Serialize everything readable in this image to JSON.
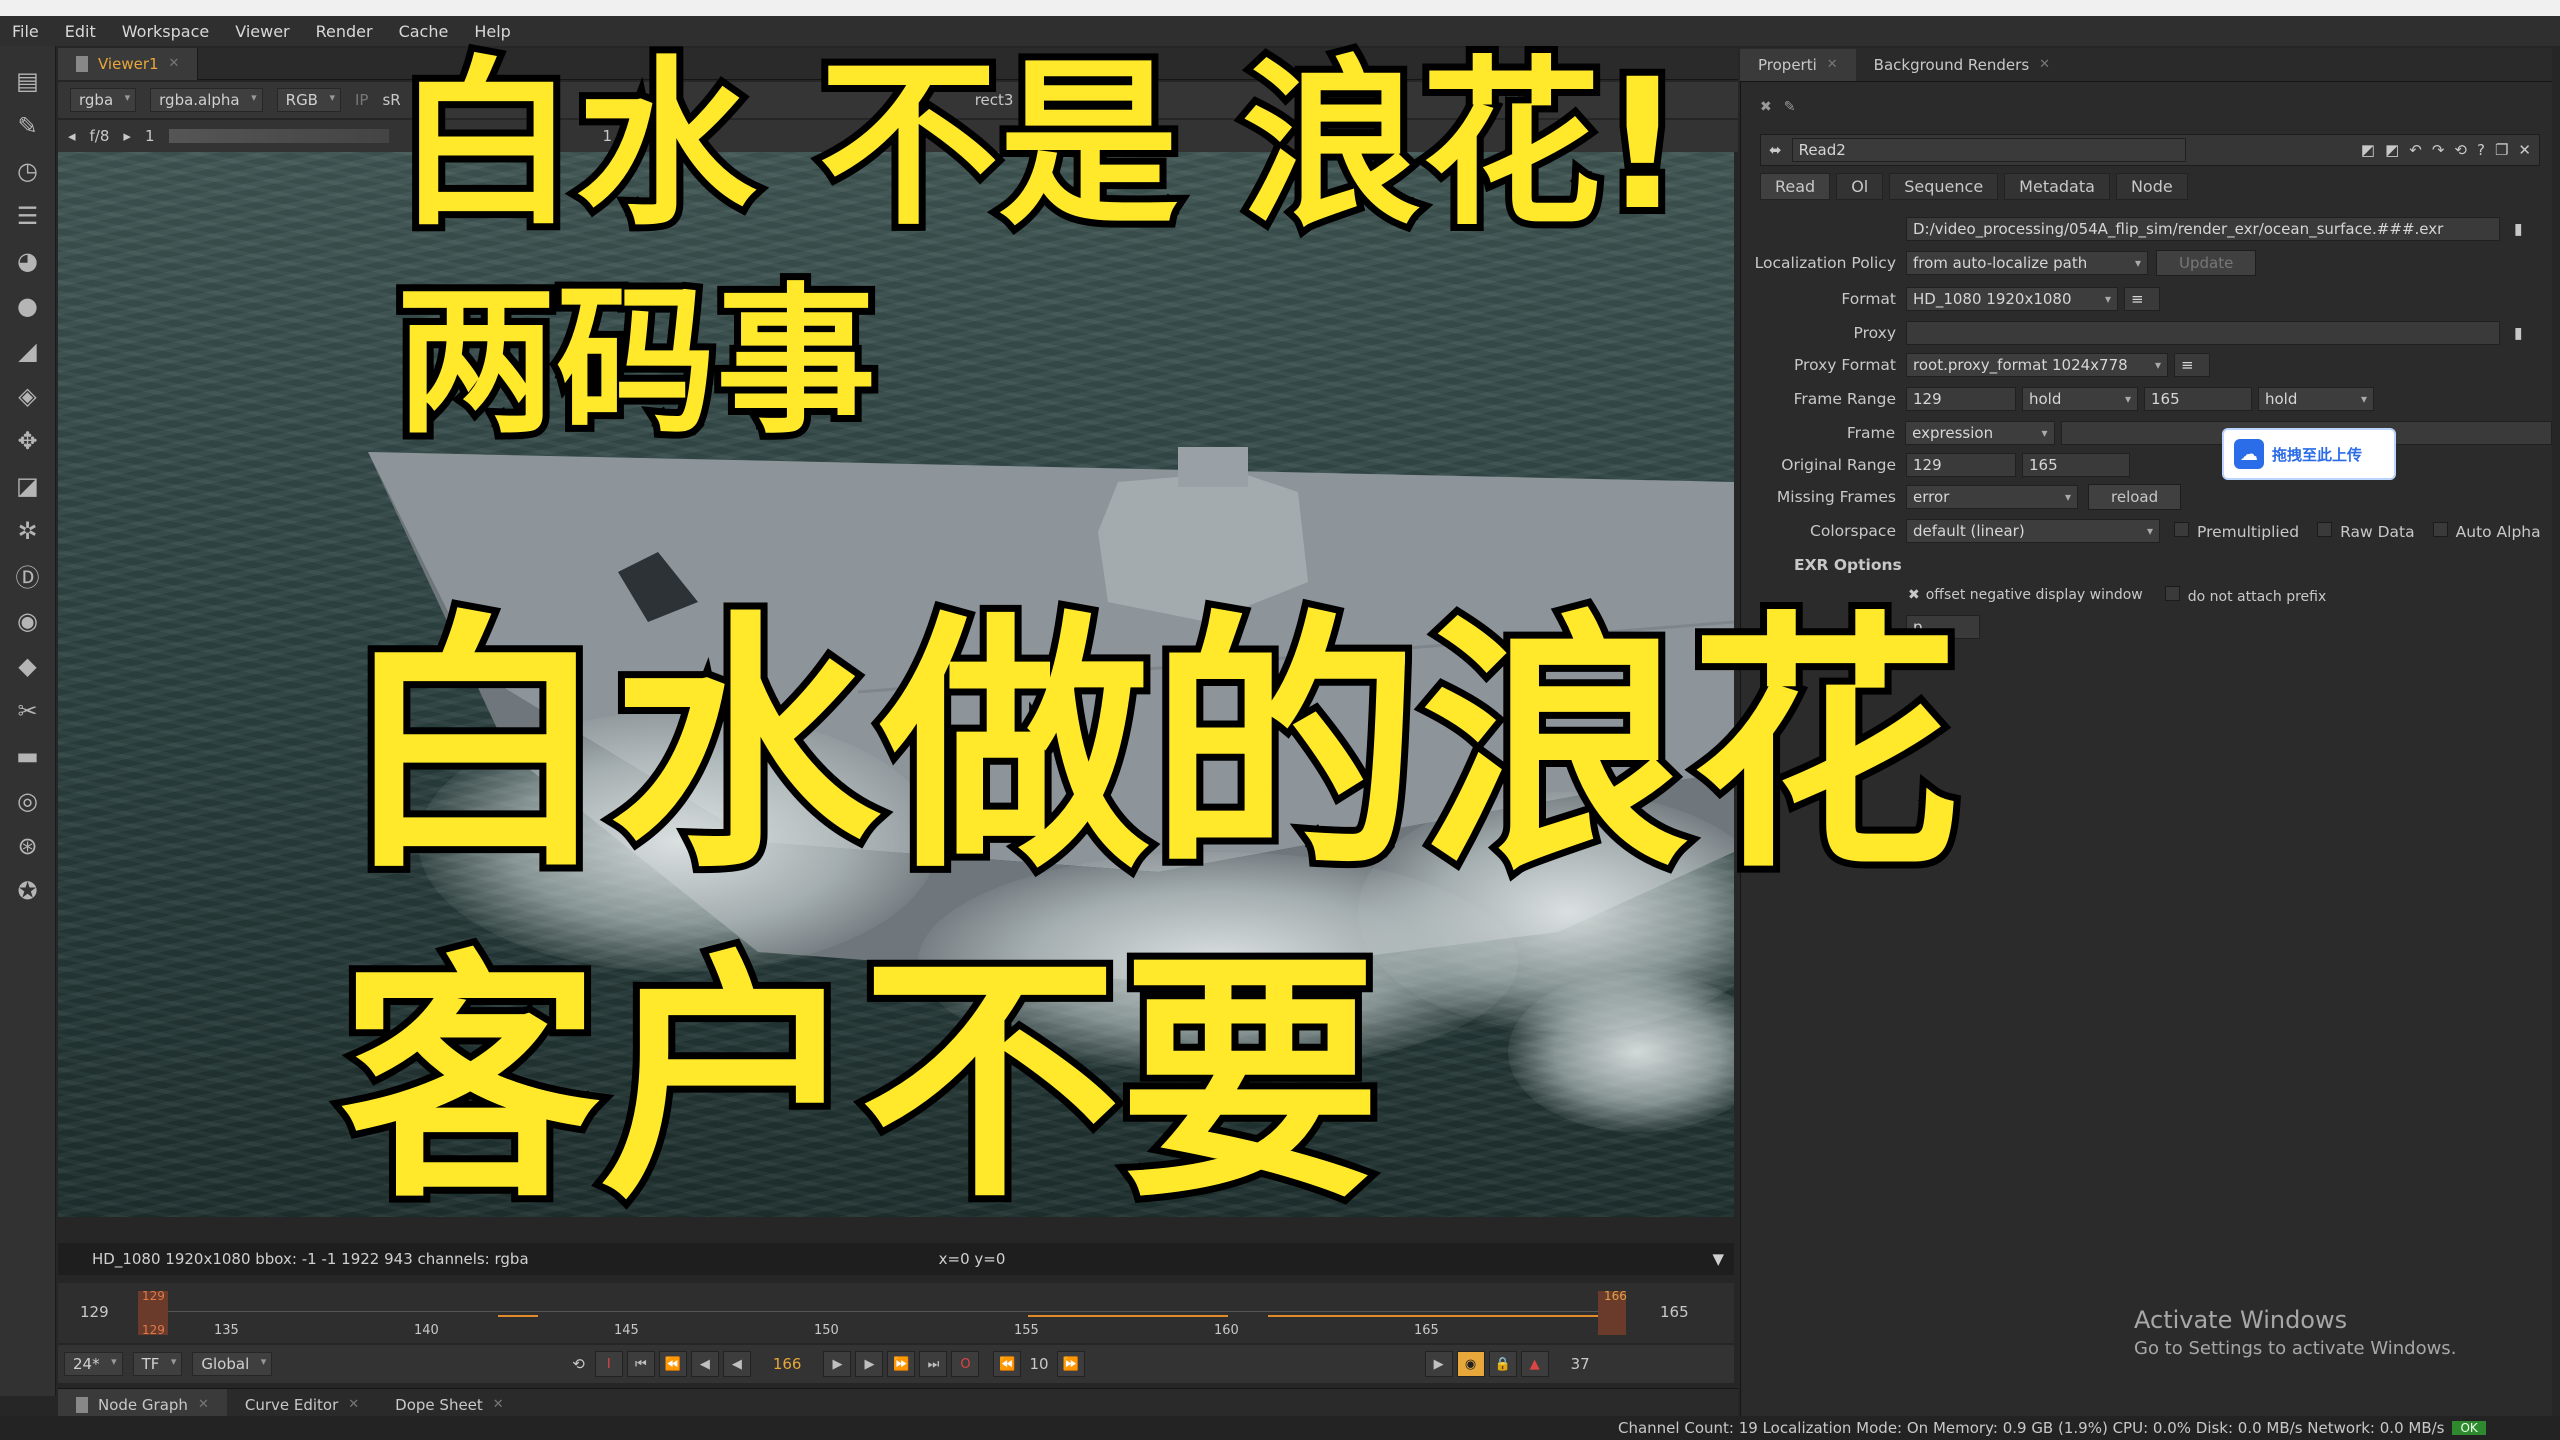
{
  "menu": [
    "File",
    "Edit",
    "Workspace",
    "Viewer",
    "Render",
    "Cache",
    "Help"
  ],
  "viewer": {
    "tab": "Viewer1",
    "channels": "rgba",
    "alpha": "rgba.alpha",
    "mode": "RGB",
    "ip": "IP",
    "colorspace": "sR",
    "crop": "rect3",
    "dash": "-",
    "fstop": "f/8",
    "gain": "1",
    "gamma_mark": "1",
    "info": "HD_1080 1920x1080  bbox: -1 -1 1922 943  channels: rgba",
    "coords": "x=0 y=0"
  },
  "timeline": {
    "start": "129",
    "end": "165",
    "in_marker": "129",
    "out_marker": "166",
    "ticks": [
      "135",
      "140",
      "145",
      "150",
      "155",
      "160",
      "165"
    ],
    "fps": "24*",
    "tf": "TF",
    "scope": "Global",
    "current_frame": "166",
    "step": "10",
    "frame_count": "37"
  },
  "bottom_tabs": [
    "Node Graph",
    "Curve Editor",
    "Dope Sheet"
  ],
  "status": "Channel Count: 19  Localization Mode: On  Memory: 0.9 GB (1.9%)  CPU: 0.0%  Disk: 0.0 MB/s  Network: 0.0 MB/s",
  "status_ok": "OK",
  "props": {
    "tabs": [
      "Properti",
      "Background Renders"
    ],
    "node_name": "Read2",
    "node_tabs": [
      "Read",
      "Ol",
      "Sequence",
      "Metadata",
      "Node"
    ],
    "file": "D:/video_processing/054A_flip_sim/render_exr/ocean_surface.###.exr",
    "localization_label": "Localization Policy",
    "localization": "from auto-localize path",
    "update_button": "Update",
    "format_label": "Format",
    "format": "HD_1080 1920x1080",
    "proxy_label": "Proxy",
    "proxy_format_label": "Proxy Format",
    "proxy_format": "root.proxy_format 1024x778",
    "frame_range_label": "Frame Range",
    "frame_range_start": "129",
    "frame_range_start_mode": "hold",
    "frame_range_end": "165",
    "frame_range_end_mode": "hold",
    "frame_label": "Frame",
    "frame_mode": "expression",
    "original_range_label": "Original Range",
    "original_range_start": "129",
    "original_range_end": "165",
    "missing_frames_label": "Missing Frames",
    "missing_frames": "error",
    "reload_button": "reload",
    "colorspace_label": "Colorspace",
    "colorspace": "default (linear)",
    "premultiplied": "Premultiplied",
    "raw_data": "Raw Data",
    "auto_alpha": "Auto Alpha",
    "exr_options": "EXR Options",
    "offset_negative": "offset negative display window",
    "no_prefix": "do not attach prefix",
    "p_field": "p"
  },
  "baidu": "拖拽至此上传",
  "activate_title": "Activate Windows",
  "activate_sub": "Go to Settings to activate Windows.",
  "overlay": {
    "line1": "白水 不是 浪花!",
    "line2": "两码事",
    "line3": "白水做的浪花",
    "line4": "客户不要"
  }
}
